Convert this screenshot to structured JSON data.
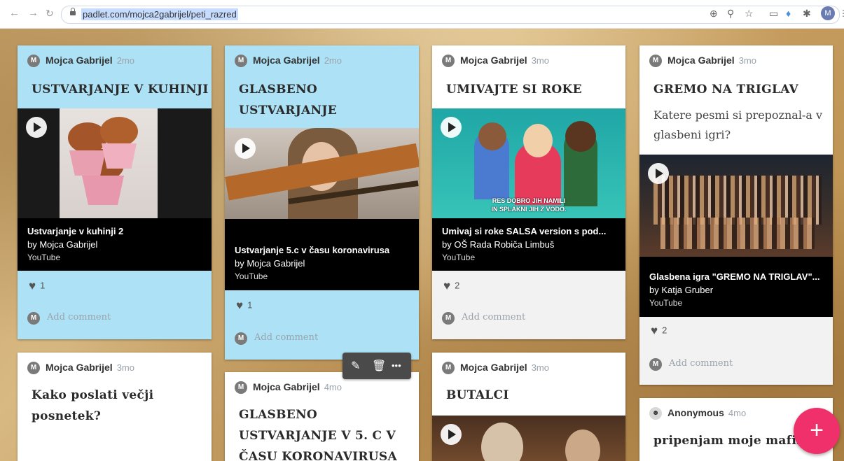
{
  "browser": {
    "url": "padlet.com/mojca2gabrijel/peti_razred",
    "profile_initial": "M"
  },
  "cards": [
    {
      "author": "Mojca Gabrijel",
      "initial": "M",
      "time": "2mo",
      "title_lines": [
        "USTVARJANJE V KUHINJI"
      ],
      "video_title": "Ustvarjanje v kuhinji 2",
      "video_by": "by Mojca Gabrijel",
      "video_source": "YouTube",
      "likes": "1",
      "comment_placeholder": "Add comment"
    },
    {
      "author": "Mojca Gabrijel",
      "initial": "M",
      "time": "2mo",
      "title_lines": [
        "GLASBENO",
        "USTVARJANJE"
      ],
      "video_title": "Ustvarjanje 5.c v času koronavirusa",
      "video_by": "by Mojca Gabrijel",
      "video_source": "YouTube",
      "likes": "1",
      "comment_placeholder": "Add comment"
    },
    {
      "author": "Mojca Gabrijel",
      "initial": "M",
      "time": "3mo",
      "title_lines": [
        "UMIVAJTE SI ROKE"
      ],
      "thumb_caption": [
        "RES DOBRO JIH NAMILI",
        "IN SPLAKNI JIH Z VODO."
      ],
      "video_title": "Umivaj si roke SALSA version s pod...",
      "video_by": "by OŠ Rada Robiča Limbuš",
      "video_source": "YouTube",
      "likes": "2",
      "comment_placeholder": "Add comment"
    },
    {
      "author": "Mojca Gabrijel",
      "initial": "M",
      "time": "3mo",
      "title_lines": [
        "GREMO NA TRIGLAV"
      ],
      "body_lines": [
        "Katere pesmi si prepoznal-a v",
        "glasbeni igri?"
      ],
      "video_title": "Glasbena igra \"GREMO NA TRIGLAV\"...",
      "video_by": "by Katja Gruber",
      "video_source": "YouTube",
      "likes": "2",
      "comment_placeholder": "Add comment"
    },
    {
      "author": "Mojca Gabrijel",
      "initial": "M",
      "time": "3mo",
      "title_lines": [
        "Kako poslati večji",
        "posnetek?"
      ]
    },
    {
      "author": "Mojca Gabrijel",
      "initial": "M",
      "time": "4mo",
      "title_lines": [
        "GLASBENO",
        "USTVARJANJE V 5. C V",
        "ČASU KORONAVIRUSA"
      ]
    },
    {
      "author": "Mojca Gabrijel",
      "initial": "M",
      "time": "3mo",
      "title_lines": [
        "BUTALCI"
      ]
    },
    {
      "author": "Anonymous",
      "time": "4mo",
      "title_lines": [
        "pripenjam moje mafine"
      ]
    }
  ],
  "fab_label": "+",
  "colors": {
    "blue_card": "#ade2f6",
    "fab": "#f0306a",
    "toolbar": "#4a4a4a"
  }
}
